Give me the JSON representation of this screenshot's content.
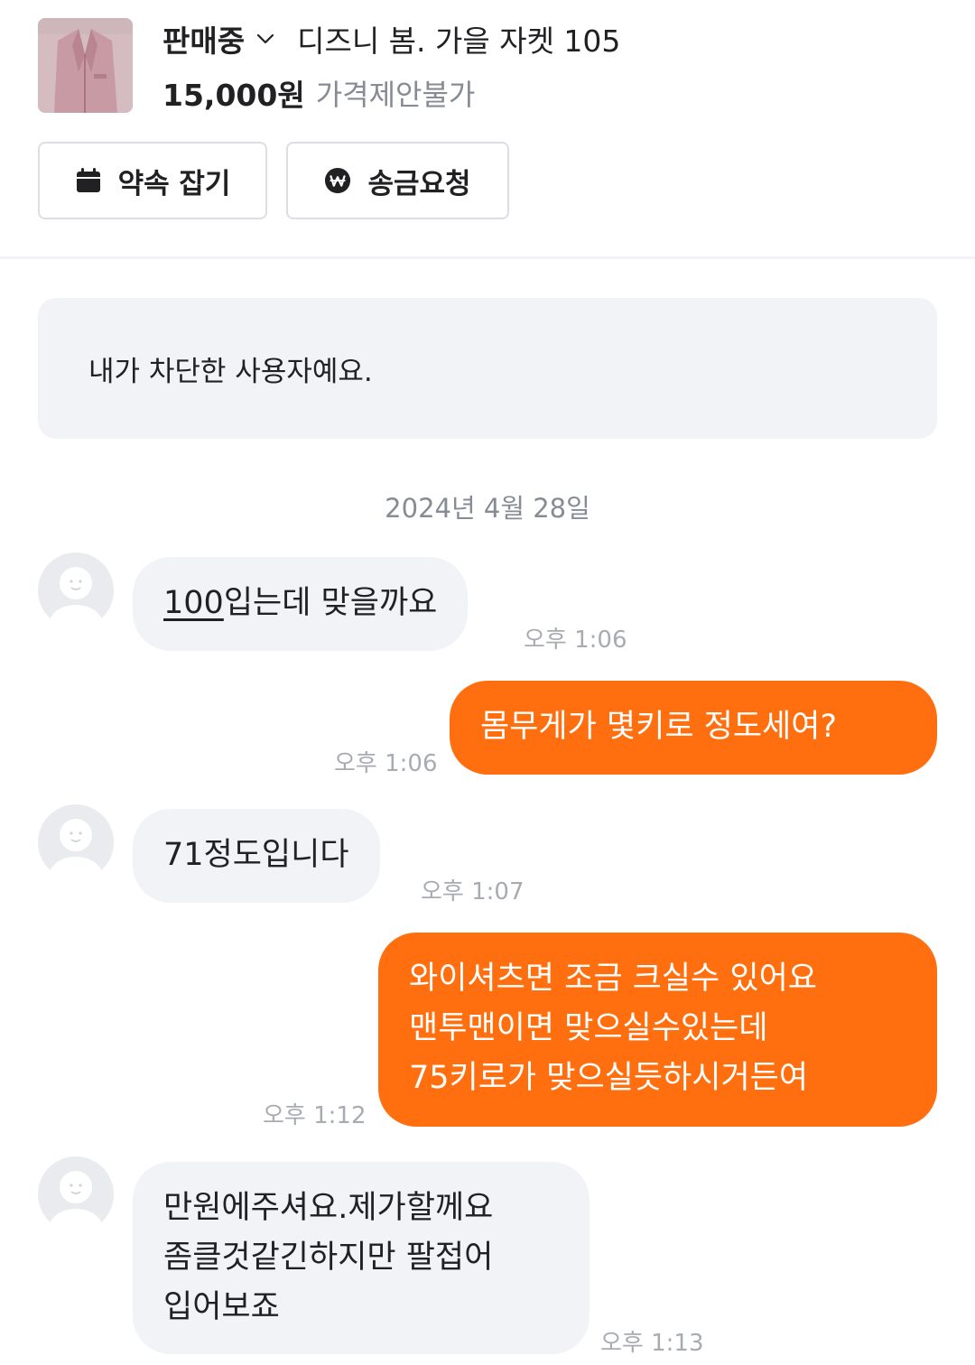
{
  "product": {
    "status": "판매중",
    "title": "디즈니 봄. 가을 자켓 105",
    "price": "15,000원",
    "price_note": "가격제안불가",
    "thumbnail_icon": "jacket-photo"
  },
  "actions": {
    "appointment_label": "약속 잡기",
    "appointment_icon": "calendar-icon",
    "remit_label": "송금요청",
    "remit_icon": "won-coin-icon"
  },
  "notice": {
    "text": "내가 차단한 사용자예요."
  },
  "date_separator": "2024년 4월 28일",
  "messages": [
    {
      "direction": "in",
      "text_link": "100",
      "text_rest": "입는데 맞을까요",
      "time": "오후 1:06"
    },
    {
      "direction": "out",
      "text": "몸무게가 몇키로 정도세여?",
      "time": "오후 1:06"
    },
    {
      "direction": "in",
      "text": "71정도입니다",
      "time": "오후 1:07"
    },
    {
      "direction": "out",
      "lines": [
        "와이셔츠면 조금 크실수 있어요",
        "맨투맨이면 맞으실수있는데",
        "75키로가 맞으실듯하시거든여"
      ],
      "time": "오후 1:12"
    },
    {
      "direction": "in",
      "lines": [
        "만원에주셔요.제가할께요",
        "좀클것같긴하지만 팔접어",
        "입어보죠"
      ],
      "time": "오후 1:13"
    }
  ],
  "colors": {
    "accent": "#ff6f0f",
    "incoming_bubble": "#f2f3f6",
    "muted_text": "#868b94"
  }
}
